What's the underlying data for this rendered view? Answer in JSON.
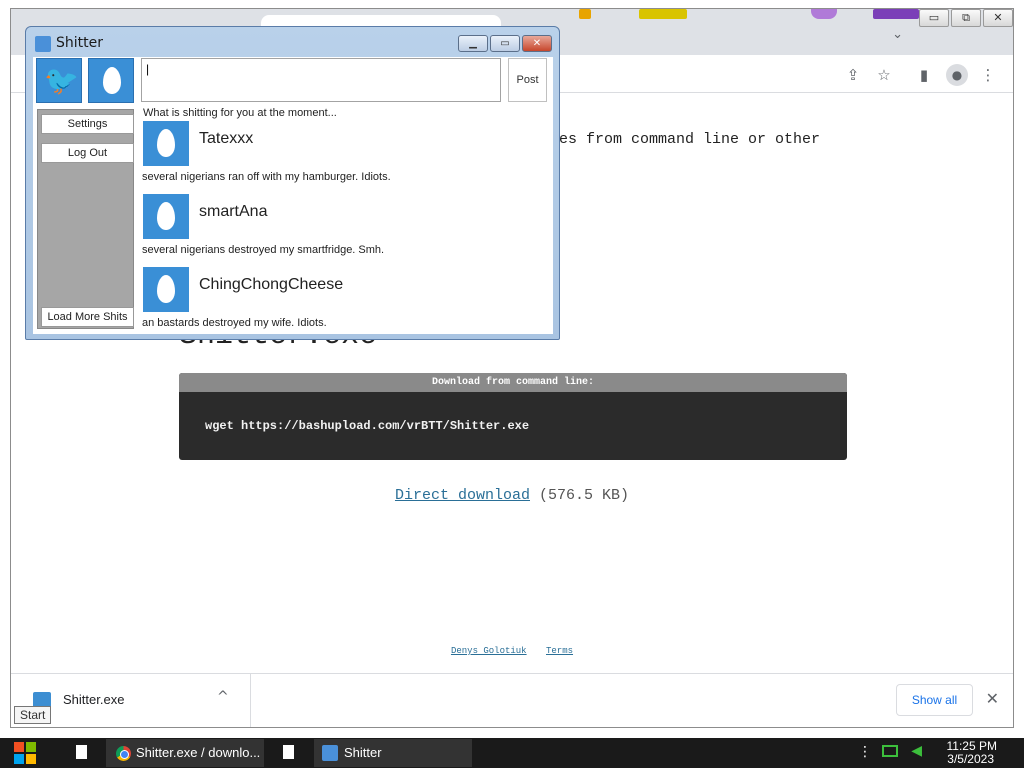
{
  "browser": {
    "toolbar_icons": [
      "share-icon",
      "bookmark-star-icon",
      "side-panel-icon",
      "profile-icon",
      "menu-icon"
    ],
    "tab_search_glyph": "⌄",
    "win_min": "▭",
    "win_restore": "⧉",
    "win_close": "✕"
  },
  "page": {
    "description_fragment": "es from command line or other",
    "title_fragment": "Shitter.exe",
    "code_box_header": "Download from command line:",
    "code_command": "wget https://bashupload.com/vrBTT/Shitter.exe",
    "direct_download_label": "Direct download",
    "file_size": "(576.5 KB)",
    "footer_links": [
      "Denys Golotiuk",
      "Terms"
    ]
  },
  "download_bar": {
    "file_name": "Shitter.exe",
    "show_all_label": "Show all",
    "close_glyph": "✕",
    "chevron_glyph": "^"
  },
  "tooltip": {
    "start_label": "Start"
  },
  "app": {
    "title": "Shitter",
    "input_value": "|",
    "post_button_label": "Post",
    "prompt": "What is shitting for you at the moment...",
    "settings_label": "Settings",
    "logout_label": "Log Out",
    "load_more_label": "Load More Shits",
    "posts": [
      {
        "user": "Tatexxx",
        "text": "several nigerians ran off with my hamburger. Idiots."
      },
      {
        "user": "smartAna",
        "text": "several nigerians destroyed my smartfridge. Smh."
      },
      {
        "user": "ChingChongCheese",
        "text": "an bastards destroyed my wife. Idiots."
      }
    ]
  },
  "taskbar": {
    "chrome_item_label": "Shitter.exe / downlo...",
    "shitter_item_label": "Shitter",
    "clock_time": "11:25 PM",
    "clock_date": "3/5/2023",
    "colors": {
      "flag_red": "#f25022",
      "flag_green": "#7fba00",
      "flag_blue": "#00a4ef",
      "flag_yellow": "#ffb900"
    }
  }
}
